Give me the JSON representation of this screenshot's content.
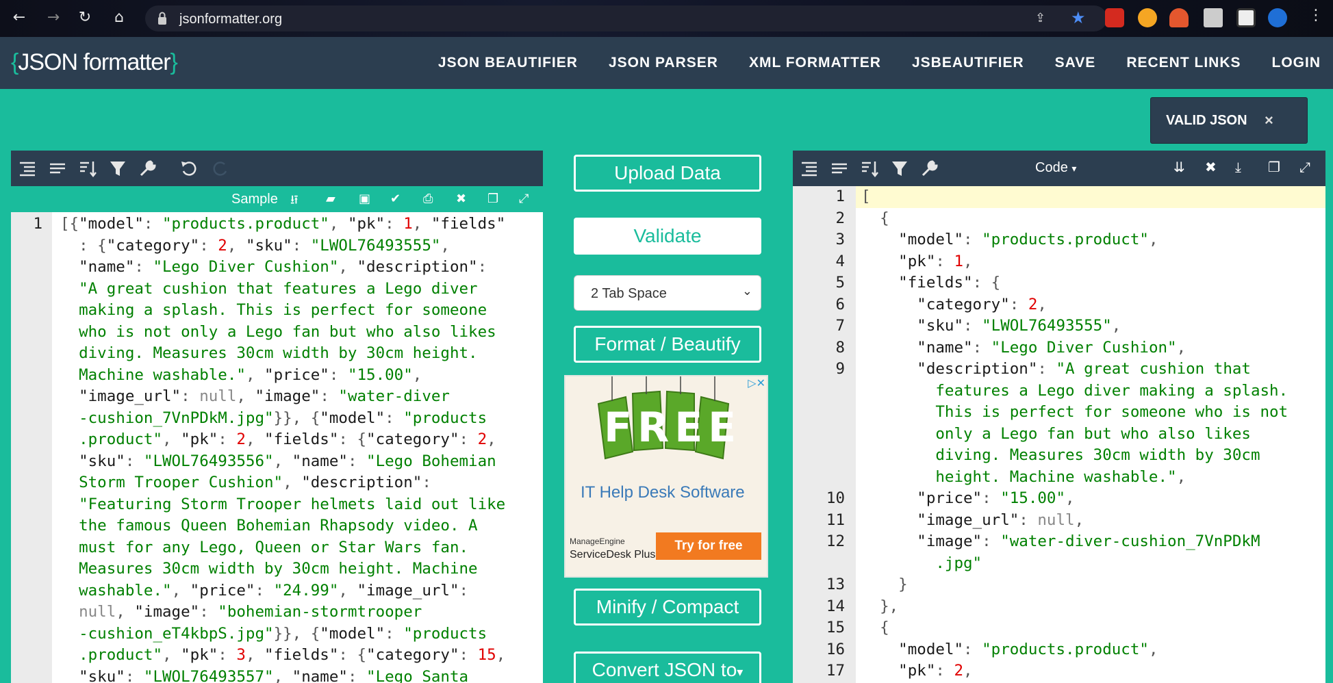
{
  "browser": {
    "url": "jsonformatter.org"
  },
  "site": {
    "logo_brace_open": "{",
    "logo_text": "JSON formatter",
    "logo_brace_close": "}",
    "nav": [
      "JSON BEAUTIFIER",
      "JSON PARSER",
      "XML FORMATTER",
      "JSBEAUTIFIER",
      "SAVE",
      "RECENT LINKS",
      "LOGIN"
    ]
  },
  "status": {
    "label": "VALID JSON",
    "close": "×"
  },
  "left_editor": {
    "sample_label": "Sample",
    "line_number": "1"
  },
  "middle": {
    "upload": "Upload Data",
    "validate": "Validate",
    "tab_space": "2 Tab Space",
    "format": "Format / Beautify",
    "minify": "Minify / Compact",
    "convert": "Convert JSON to"
  },
  "ad": {
    "banner": "FREE",
    "title": "IT Help Desk Software",
    "brand_small": "ManageEngine",
    "brand": "ServiceDesk Plus",
    "cta": "Try for free"
  },
  "right_editor": {
    "mode_label": "Code",
    "line_numbers": [
      "1",
      "2",
      "3",
      "4",
      "5",
      "6",
      "7",
      "8",
      "9",
      "",
      "",
      "",
      "",
      "",
      "10",
      "11",
      "12",
      "",
      "13",
      "14",
      "15",
      "16",
      "17"
    ]
  }
}
